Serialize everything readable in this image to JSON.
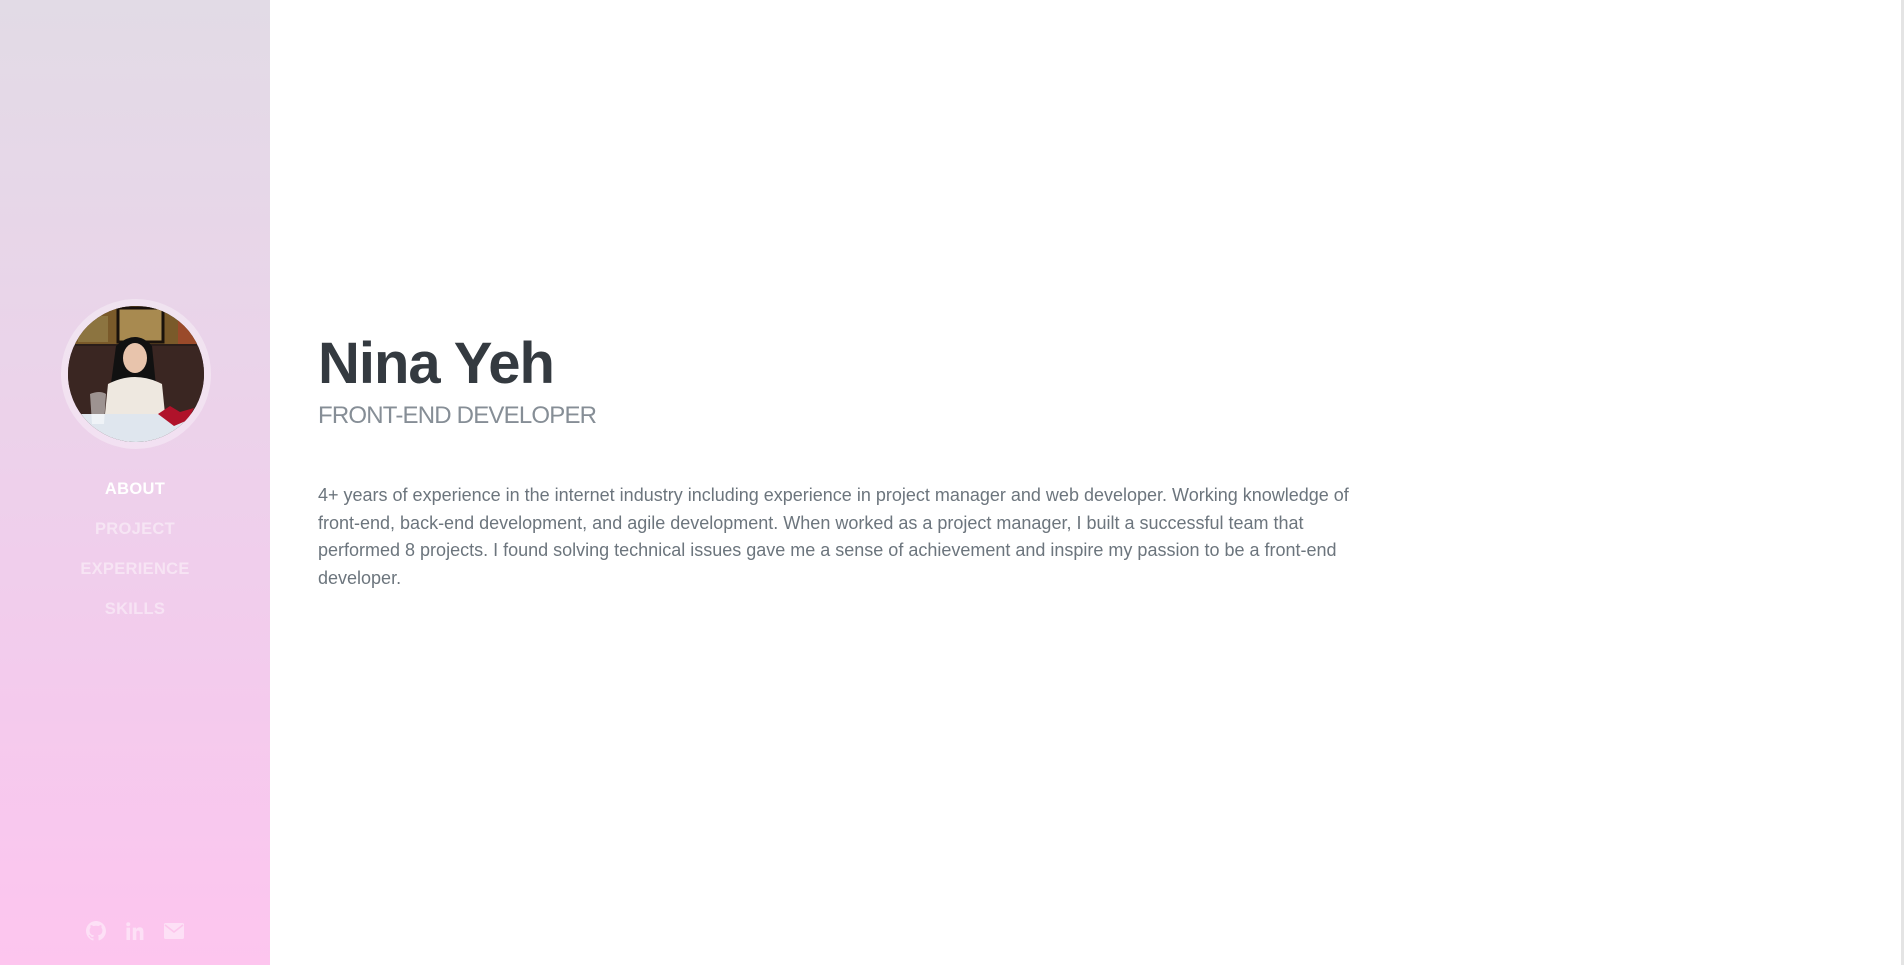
{
  "sidebar": {
    "nav": [
      {
        "label": "ABOUT",
        "active": true
      },
      {
        "label": "PROJECT"
      },
      {
        "label": "EXPERIENCE"
      },
      {
        "label": "SKILLS"
      }
    ],
    "social": [
      "github-icon",
      "linkedin-icon",
      "envelope-icon"
    ]
  },
  "about": {
    "name": "Nina Yeh",
    "title": "FRONT-END DEVELOPER",
    "bio": "4+ years of experience in the internet industry including experience in project manager and web developer. Working knowledge of front-end, back-end development, and agile development. When worked as a project manager, I built a successful team that performed 8 projects. I found solving technical issues gave me a sense of achievement and inspire my passion to be a front-end developer."
  },
  "colors": {
    "gradient_top": "#e2dbe6",
    "gradient_bottom": "#fdc5ee",
    "heading": "#343a40",
    "text": "#6c757d"
  }
}
